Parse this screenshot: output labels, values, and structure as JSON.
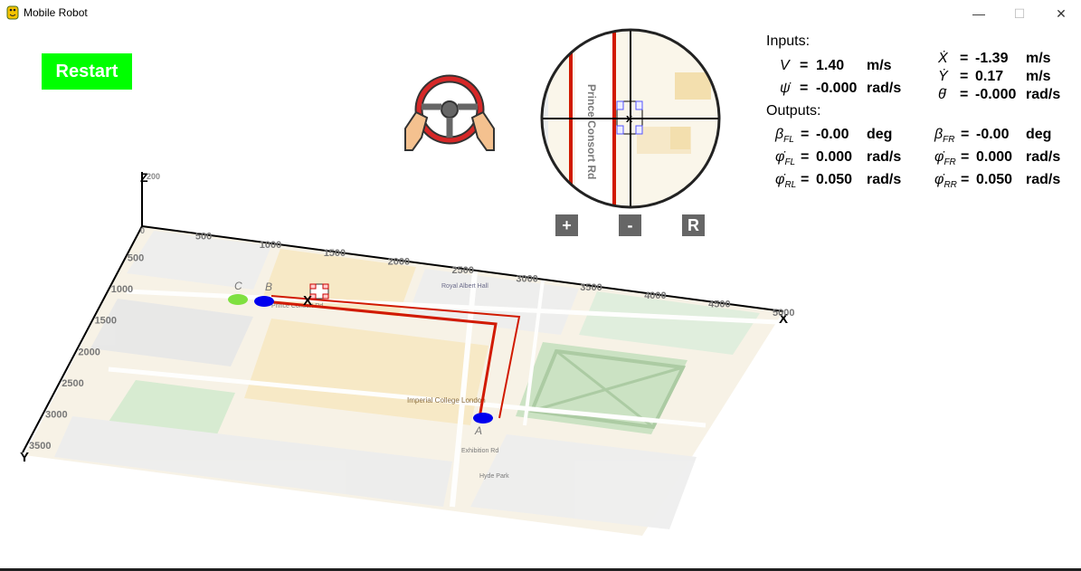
{
  "window": {
    "title": "Mobile Robot",
    "minimize": "—",
    "maximize": "☐",
    "close": "✕"
  },
  "controls": {
    "restart": "Restart",
    "zoom_in": "+",
    "zoom_out": "-",
    "reset": "R"
  },
  "minimap": {
    "street_label": "Prince Consort Rd",
    "robot_marker": "x"
  },
  "inputs": {
    "heading": "Inputs:",
    "V": {
      "symbol": "V",
      "value": "1.40",
      "unit": "m/s"
    },
    "psi_dot": {
      "symbol": "ψ̇",
      "value": "-0.000",
      "unit": "rad/s"
    },
    "X_dot": {
      "symbol": "Ẋ",
      "value": "-1.39",
      "unit": "m/s"
    },
    "Y_dot": {
      "symbol": "Ẏ",
      "value": "0.17",
      "unit": "m/s"
    },
    "theta_dot": {
      "symbol": "θ̇",
      "value": "-0.000",
      "unit": "rad/s"
    }
  },
  "outputs": {
    "heading": "Outputs:",
    "beta_FL": {
      "symbol": "β",
      "sub": "FL",
      "value": "-0.00",
      "unit": "deg"
    },
    "beta_FR": {
      "symbol": "β",
      "sub": "FR",
      "value": "-0.00",
      "unit": "deg"
    },
    "phi_FL": {
      "symbol": "φ̇",
      "sub": "FL",
      "value": "0.000",
      "unit": "rad/s"
    },
    "phi_FR": {
      "symbol": "φ̇",
      "sub": "FR",
      "value": "0.000",
      "unit": "rad/s"
    },
    "phi_RL": {
      "symbol": "φ̇",
      "sub": "RL",
      "value": "0.050",
      "unit": "rad/s"
    },
    "phi_RR": {
      "symbol": "φ̇",
      "sub": "RR",
      "value": "0.050",
      "unit": "rad/s"
    }
  },
  "plot3d": {
    "axis_x_label": "X",
    "axis_y_label": "Y",
    "axis_z_label": "Z",
    "z_tick": "200",
    "origin_tick": "0",
    "x_ticks": [
      "500",
      "1000",
      "1500",
      "2000",
      "2500",
      "3000",
      "3500",
      "4000",
      "4500",
      "5000"
    ],
    "y_ticks": [
      "500",
      "1000",
      "1500",
      "2000",
      "2500",
      "3000",
      "3500"
    ],
    "waypoints": [
      "A",
      "B",
      "C"
    ],
    "robot_label": "X",
    "map_labels": [
      "Imperial College London",
      "Royal Albert Hall",
      "Prince Consort Rd",
      "Exhibition Rd",
      "Hyde Park"
    ]
  },
  "colors": {
    "restart_bg": "#00ff00",
    "path": "#d11a00",
    "waypoint_b": "#0000ee",
    "waypoint_c": "#7fe040",
    "button_bg": "#666666"
  }
}
